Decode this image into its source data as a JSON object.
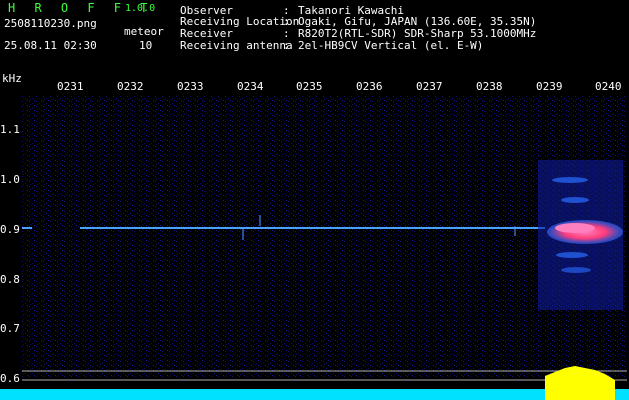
{
  "header": {
    "app_title": "H R O F F T",
    "app_version": "1.0.0",
    "file_name": "2508110230.png",
    "timestamp": "25.08.11 02:30",
    "meteor_label": "meteor",
    "meteor_count": "10"
  },
  "info": [
    {
      "key": "Observer",
      "value": "Takanori Kawachi"
    },
    {
      "key": "Receiving Location",
      "value": "Ogaki, Gifu, JAPAN (136.60E, 35.35N)"
    },
    {
      "key": "Receiver",
      "value": "R820T2(RTL-SDR) SDR-Sharp 53.1000MHz"
    },
    {
      "key": "Receiving antenna",
      "value": "2el-HB9CV Vertical (el. E-W)"
    }
  ],
  "axis": {
    "y_unit": "kHz",
    "x_ticks": [
      "0231",
      "0232",
      "0233",
      "0234",
      "0235",
      "0236",
      "0237",
      "0238",
      "0239",
      "0240"
    ],
    "y_ticks": [
      "1.1",
      "1.0",
      "0.9",
      "0.8",
      "0.7",
      "0.6"
    ]
  },
  "colors": {
    "background": "#000000",
    "noise": "#0a0a66",
    "carrier": "#4aa0ff",
    "meteor_hot": "#ff3c7a",
    "meteor_core": "#ff7fbf",
    "meter_fill": "#00e0ff",
    "meter_peak": "#ffff00",
    "guide_line": "#b0b0b0"
  }
}
